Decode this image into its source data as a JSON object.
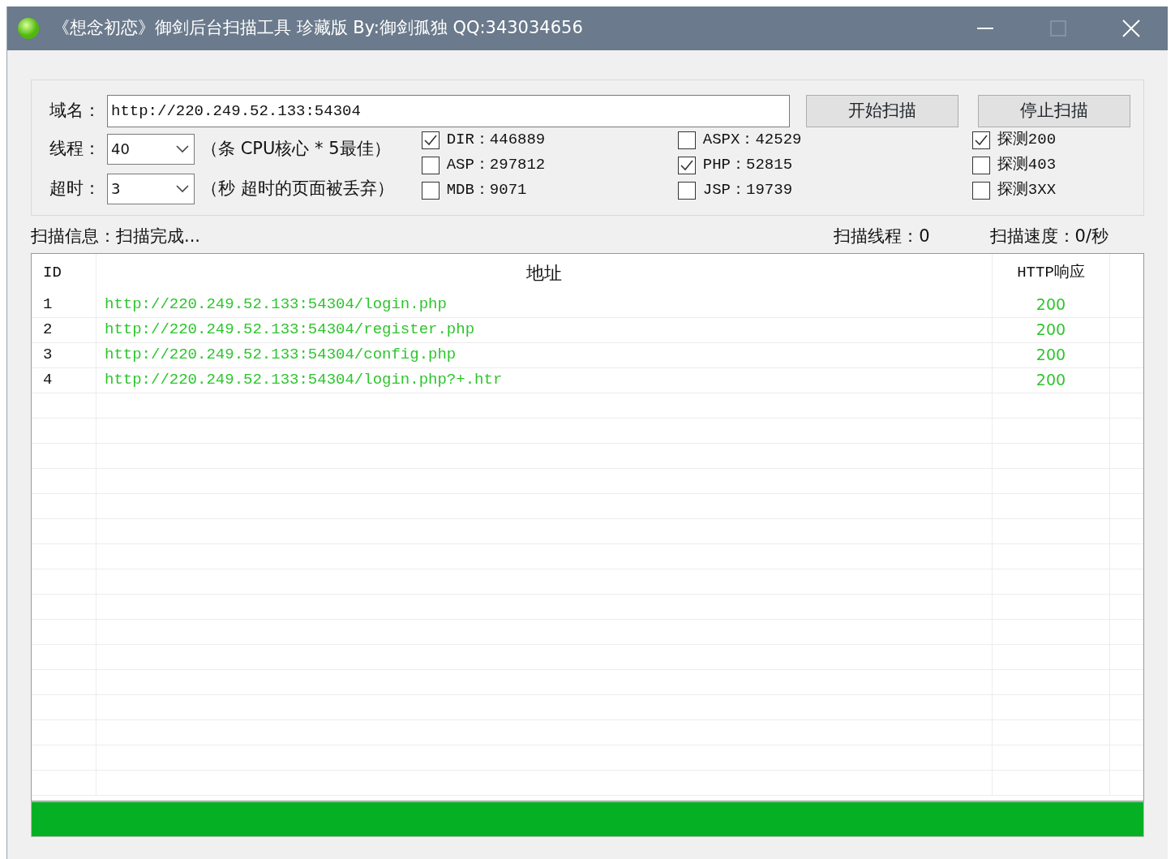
{
  "window": {
    "title": "《想念初恋》御剑后台扫描工具 珍藏版 By:御剑孤独 QQ:343034656"
  },
  "domain": {
    "label": "域名：",
    "value": "http://220.249.52.133:54304"
  },
  "buttons": [
    "开始扫描",
    "停止扫描"
  ],
  "settings": [
    {
      "label": "线程：",
      "value": "40",
      "hint": "（条 CPU核心 * 5最佳）"
    },
    {
      "label": "超时：",
      "value": "3",
      "hint": "（秒 超时的页面被丢弃）"
    }
  ],
  "option_columns": [
    {
      "items": [
        {
          "label": "DIR：446889",
          "checked": true
        },
        {
          "label": "ASP：297812",
          "checked": false
        },
        {
          "label": "MDB：9071",
          "checked": false
        }
      ]
    },
    {
      "items": [
        {
          "label": "ASPX：42529",
          "checked": false
        },
        {
          "label": "PHP：52815",
          "checked": true
        },
        {
          "label": "JSP：19739",
          "checked": false
        }
      ]
    },
    {
      "items": [
        {
          "label": "探测200",
          "checked": true
        },
        {
          "label": "探测403",
          "checked": false
        },
        {
          "label": "探测3XX",
          "checked": false
        }
      ]
    }
  ],
  "status": {
    "info": "扫描信息：扫描完成...",
    "threads": "扫描线程：0",
    "speed": "扫描速度：0/秒"
  },
  "table": {
    "columns": [
      "ID",
      "地址",
      "HTTP响应"
    ],
    "rows": [
      {
        "id": "1",
        "url": "http://220.249.52.133:54304/login.php",
        "code": "200"
      },
      {
        "id": "2",
        "url": "http://220.249.52.133:54304/register.php",
        "code": "200"
      },
      {
        "id": "3",
        "url": "http://220.249.52.133:54304/config.php",
        "code": "200"
      },
      {
        "id": "4",
        "url": "http://220.249.52.133:54304/login.php?+.htr",
        "code": "200"
      }
    ]
  },
  "progress": {
    "level": 1
  }
}
